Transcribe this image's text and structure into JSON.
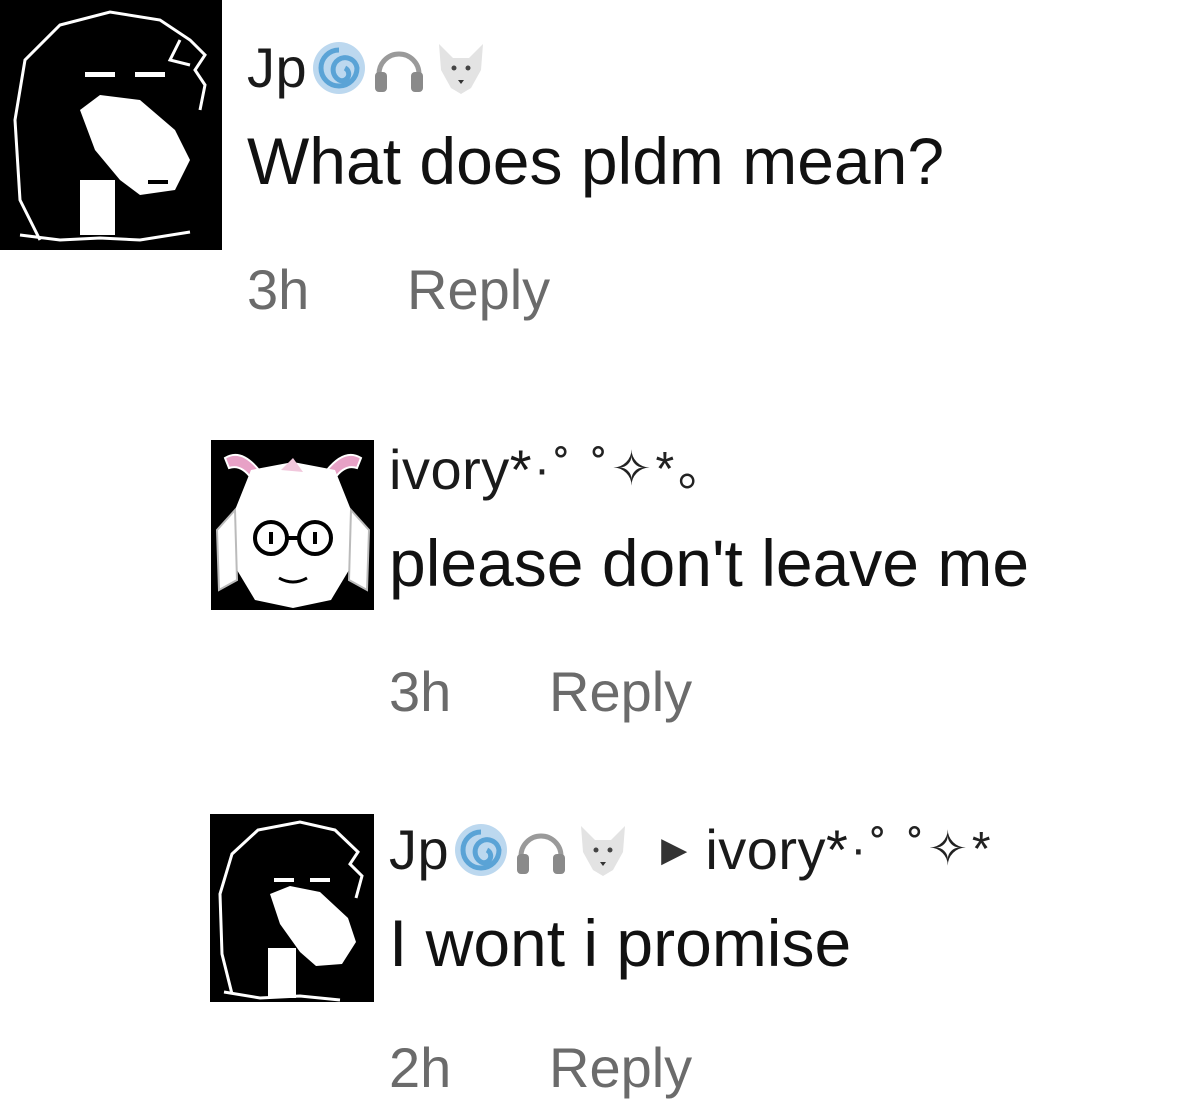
{
  "comments": [
    {
      "user": "Jp",
      "emoji": [
        "cyclone-emoji",
        "headphones-emoji",
        "wolf-emoji"
      ],
      "text": "What does pldm mean?",
      "time": "3h",
      "reply_label": "Reply"
    },
    {
      "user": "ivory*",
      "user_deco": "·˚ ˚✧*｡",
      "text": "please don't leave me",
      "time": "3h",
      "reply_label": "Reply"
    },
    {
      "user": "Jp",
      "emoji": [
        "cyclone-emoji",
        "headphones-emoji",
        "wolf-emoji"
      ],
      "reply_to": "ivory*",
      "reply_to_deco": "·˚ ˚✧*",
      "text": "I wont i promise",
      "time": "2h",
      "reply_label": "Reply"
    }
  ]
}
